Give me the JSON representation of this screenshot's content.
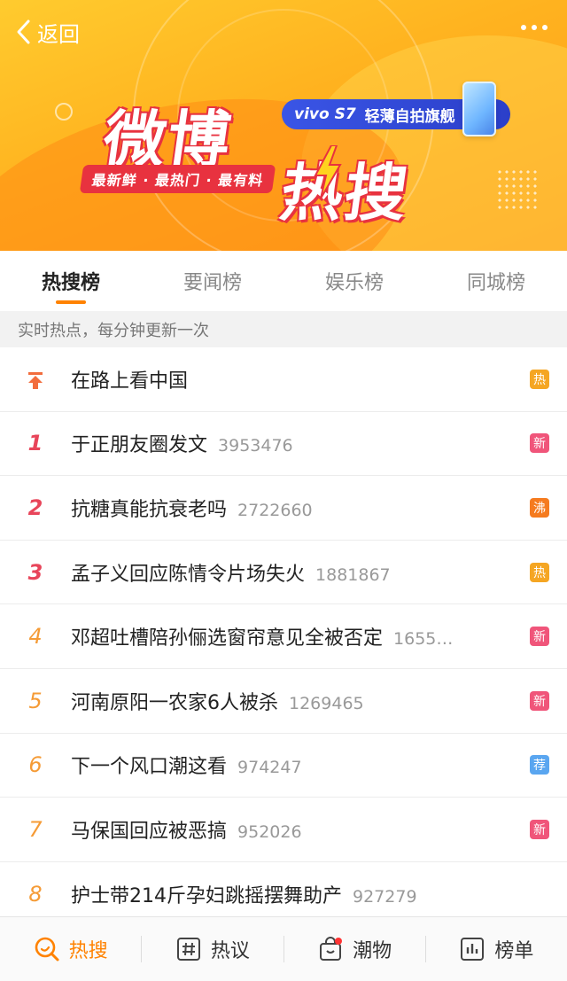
{
  "header": {
    "back_label": "返回",
    "back_icon": "chevron-left-icon",
    "more_icon": "more-dots-icon"
  },
  "banner": {
    "logo_line1": "微博",
    "logo_line2": "热搜",
    "slogan": "最新鲜 · 最热门 · 最有料",
    "sponsor_brand": "vivo S7",
    "sponsor_tagline": "轻薄自拍旗舰"
  },
  "tabs": [
    {
      "label": "热搜榜",
      "active": true
    },
    {
      "label": "要闻榜",
      "active": false
    },
    {
      "label": "娱乐榜",
      "active": false
    },
    {
      "label": "同城榜",
      "active": false
    }
  ],
  "subtitle": "实时热点，每分钟更新一次",
  "list": [
    {
      "rank": "",
      "rank_icon": "pin-top-icon",
      "title": "在路上看中国",
      "count": "",
      "badge": "热",
      "badge_color": "#f5a623"
    },
    {
      "rank": "1",
      "title": "于正朋友圈发文",
      "count": "3953476",
      "badge": "新",
      "badge_color": "#f0557a"
    },
    {
      "rank": "2",
      "title": "抗糖真能抗衰老吗",
      "count": "2722660",
      "badge": "沸",
      "badge_color": "#f57b1f"
    },
    {
      "rank": "3",
      "title": "孟子义回应陈情令片场失火",
      "count": "1881867",
      "badge": "热",
      "badge_color": "#f5a623"
    },
    {
      "rank": "4",
      "title": "邓超吐槽陪孙俪选窗帘意见全被否定",
      "count": "1655…",
      "badge": "新",
      "badge_color": "#f0557a"
    },
    {
      "rank": "5",
      "title": "河南原阳一农家6人被杀",
      "count": "1269465",
      "badge": "新",
      "badge_color": "#f0557a"
    },
    {
      "rank": "6",
      "title": "下一个风口潮这看",
      "count": "974247",
      "badge": "荐",
      "badge_color": "#5aa6f0"
    },
    {
      "rank": "7",
      "title": "马保国回应被恶搞",
      "count": "952026",
      "badge": "新",
      "badge_color": "#f0557a"
    },
    {
      "rank": "8",
      "title": "护士带214斤孕妇跳摇摆舞助产",
      "count": "927279",
      "badge": "",
      "badge_color": ""
    }
  ],
  "bottom_nav": [
    {
      "label": "热搜",
      "icon": "search-hot-icon",
      "active": true
    },
    {
      "label": "热议",
      "icon": "hashtag-icon",
      "active": false
    },
    {
      "label": "潮物",
      "icon": "shopping-bag-icon",
      "active": false,
      "dot": true
    },
    {
      "label": "榜单",
      "icon": "chart-list-icon",
      "active": false
    }
  ],
  "colors": {
    "accent": "#ff8200",
    "banner_yellow": "#ffb21f",
    "logo_red": "#e8323f"
  }
}
